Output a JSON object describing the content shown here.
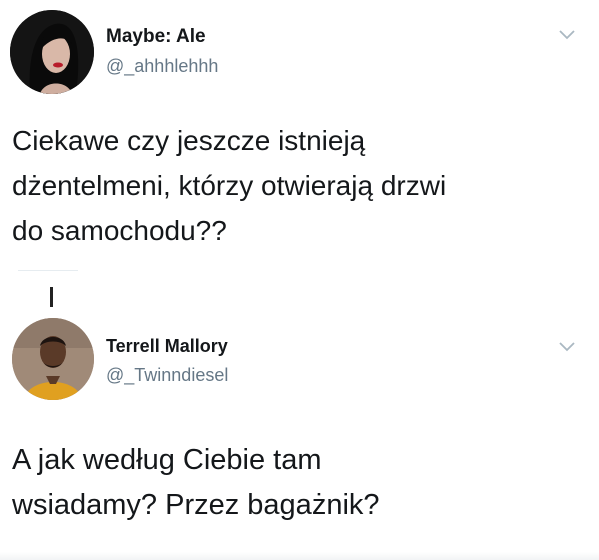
{
  "tweets": [
    {
      "display_name": "Maybe: Ale",
      "handle": "@_ahhhlehhh",
      "text_lines": [
        "Ciekawe czy jeszcze istnieją",
        "dżentelmeni, którzy otwierają drzwi",
        "do samochodu??"
      ]
    },
    {
      "display_name": "Terrell Mallory",
      "handle": "@_Twinndiesel",
      "text_lines": [
        "A jak według Ciebie tam",
        "wsiadamy? Przez bagażnik?"
      ]
    }
  ],
  "icons": {
    "menu": "chevron-down-icon",
    "avatar": "avatar"
  },
  "colors": {
    "text": "#14171a",
    "secondary_text": "#657786",
    "chevron": "#aab8c2",
    "background": "#ffffff"
  }
}
